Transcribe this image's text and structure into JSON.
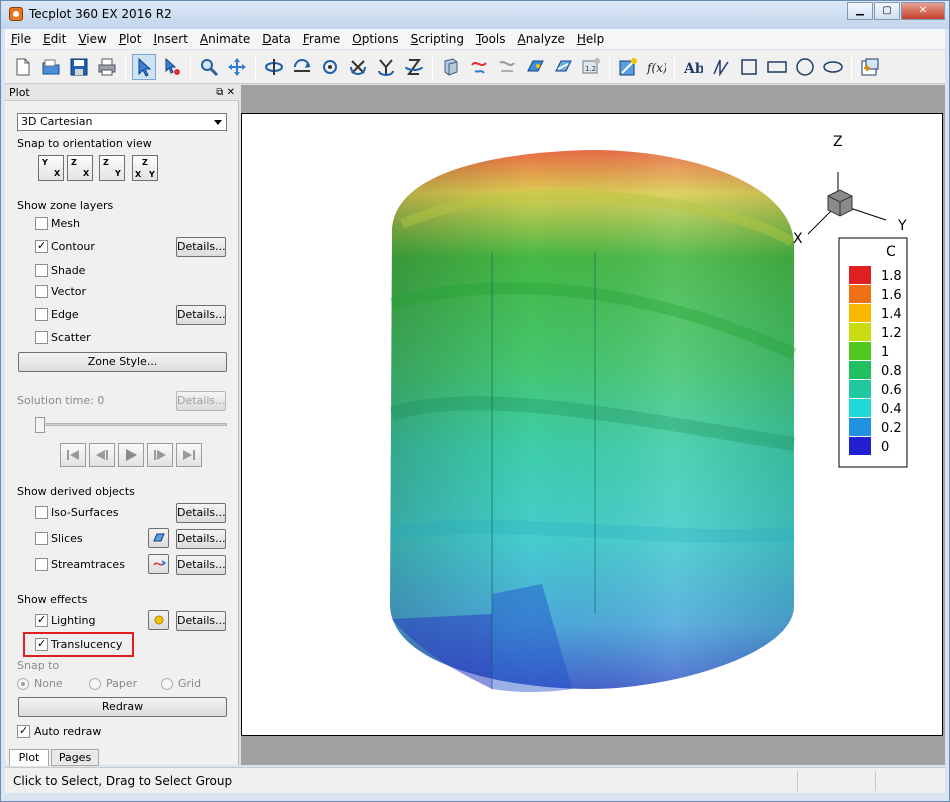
{
  "window": {
    "title": "Tecplot 360 EX 2016 R2"
  },
  "menubar": [
    {
      "u": "F",
      "rest": "ile"
    },
    {
      "u": "E",
      "rest": "dit"
    },
    {
      "u": "V",
      "rest": "iew"
    },
    {
      "u": "P",
      "rest": "lot"
    },
    {
      "u": "I",
      "rest": "nsert"
    },
    {
      "u": "A",
      "rest": "nimate"
    },
    {
      "u": "D",
      "rest": "ata"
    },
    {
      "u": "F",
      "rest": "rame"
    },
    {
      "u": "O",
      "rest": "ptions"
    },
    {
      "u": "S",
      "rest": "cripting"
    },
    {
      "u": "T",
      "rest": "ools"
    },
    {
      "u": "A",
      "rest": "nalyze"
    },
    {
      "u": "H",
      "rest": "elp"
    }
  ],
  "panel": {
    "title": "Plot",
    "plot_type": "3D Cartesian",
    "snap_orientation_label": "Snap to orientation view",
    "zone_layers_label": "Show zone layers",
    "zone_layers": [
      {
        "label": "Mesh",
        "checked": false
      },
      {
        "label": "Contour",
        "checked": true,
        "details": "Details..."
      },
      {
        "label": "Shade",
        "checked": false
      },
      {
        "label": "Vector",
        "checked": false
      },
      {
        "label": "Edge",
        "checked": false,
        "details": "Details..."
      },
      {
        "label": "Scatter",
        "checked": false
      }
    ],
    "zone_style_button": "Zone Style...",
    "solution_time_label": "Solution time: 0",
    "solution_details": "Details...",
    "derived_label": "Show derived objects",
    "derived": [
      {
        "label": "Iso-Surfaces",
        "checked": false,
        "details": "Details..."
      },
      {
        "label": "Slices",
        "checked": false,
        "details": "Details..."
      },
      {
        "label": "Streamtraces",
        "checked": false,
        "details": "Details..."
      }
    ],
    "effects_label": "Show effects",
    "effects": [
      {
        "label": "Lighting",
        "checked": true,
        "details": "Details..."
      },
      {
        "label": "Translucency",
        "checked": true
      }
    ],
    "snap_to_label": "Snap to",
    "snap_to_options": [
      "None",
      "Paper",
      "Grid"
    ],
    "redraw_button": "Redraw",
    "auto_redraw_label": "Auto redraw",
    "auto_redraw": true,
    "tabs": [
      "Plot",
      "Pages"
    ]
  },
  "legend": {
    "title": "C",
    "levels": [
      "1.8",
      "1.6",
      "1.4",
      "1.2",
      "1",
      "0.8",
      "0.6",
      "0.4",
      "0.2",
      "0"
    ],
    "colors": [
      "#e02020",
      "#f07018",
      "#f8b800",
      "#c8dc10",
      "#50c820",
      "#20c060",
      "#20c8a0",
      "#20d8d8",
      "#2090e0",
      "#2020d0"
    ]
  },
  "axes": {
    "x": "X",
    "y": "Y",
    "z": "Z"
  },
  "status": {
    "text": "Click to Select, Drag to Select Group"
  }
}
